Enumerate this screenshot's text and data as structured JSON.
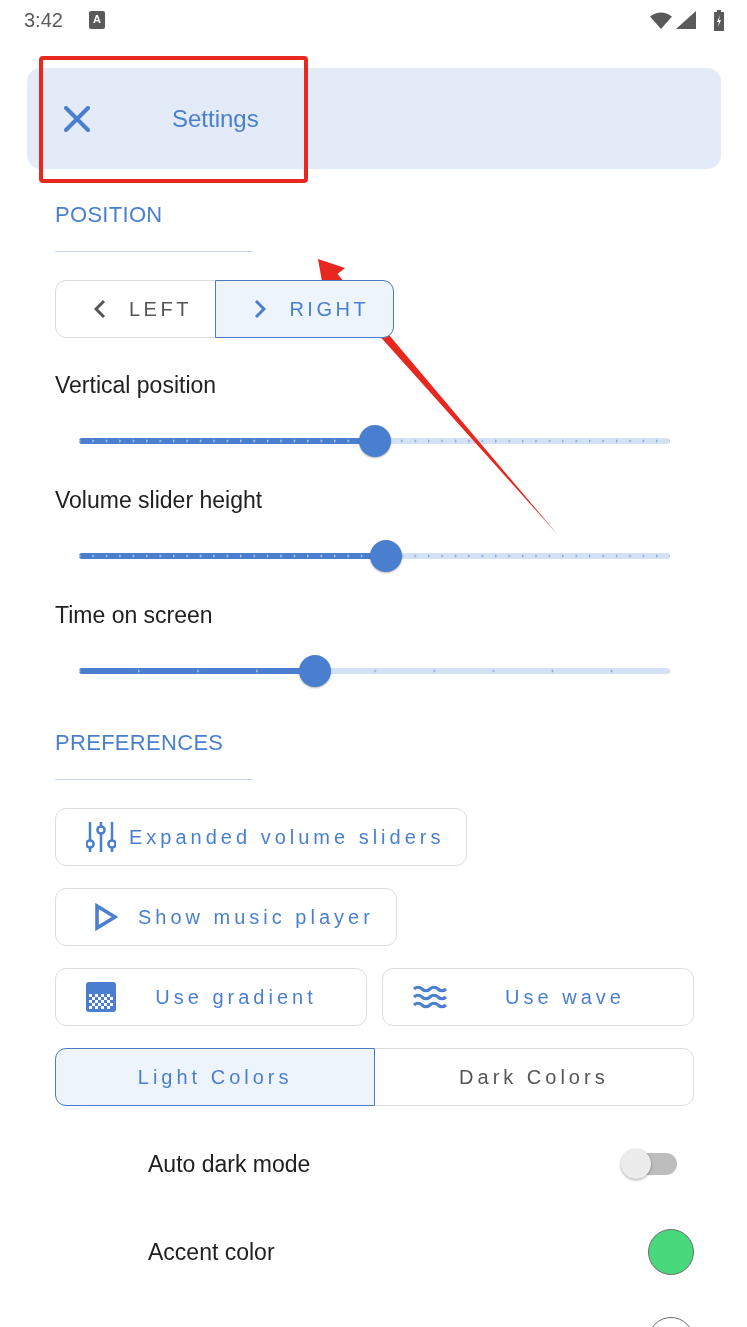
{
  "status_bar": {
    "time": "3:42",
    "notification_glyph": "A"
  },
  "header": {
    "title": "Settings"
  },
  "position": {
    "title": "POSITION",
    "side_options": [
      {
        "label": "LEFT",
        "selected": false
      },
      {
        "label": "RIGHT",
        "selected": true
      }
    ],
    "sliders": [
      {
        "label": "Vertical position",
        "kind": "dense",
        "level": 0.5
      },
      {
        "label": "Volume slider height",
        "kind": "dense",
        "level": 0.52
      },
      {
        "label": "Time on screen",
        "kind": "sparse",
        "level": 0.4
      }
    ]
  },
  "preferences": {
    "title": "PREFERENCES",
    "option_buttons": [
      {
        "label": "Expanded volume sliders"
      },
      {
        "label": "Show music player"
      }
    ],
    "style_buttons": [
      {
        "label": "Use gradient"
      },
      {
        "label": "Use wave"
      }
    ],
    "theme_options": [
      {
        "label": "Light Colors",
        "selected": true
      },
      {
        "label": "Dark Colors",
        "selected": false
      }
    ],
    "settings": [
      {
        "kind": "switch",
        "label": "Auto dark mode",
        "on": false
      },
      {
        "kind": "color",
        "label": "Accent color",
        "color": "#48d97c"
      },
      {
        "kind": "color",
        "color": "#ffffff"
      }
    ]
  }
}
